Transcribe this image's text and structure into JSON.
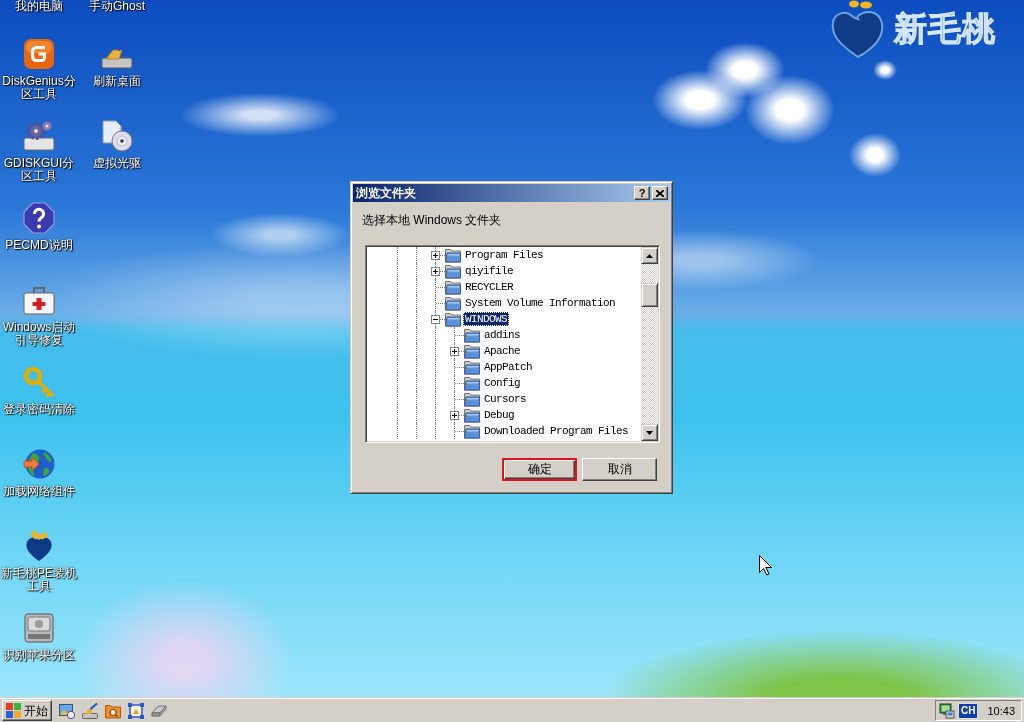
{
  "desktop_icons": {
    "columns": [
      [
        {
          "label": "我的电脑"
        },
        {
          "label": "DiskGenius分区工具"
        },
        {
          "label": "GDISKGUI分区工具"
        },
        {
          "label": "PECMD说明"
        },
        {
          "label": "Windows启动引导修复"
        },
        {
          "label": "登录密码清除"
        },
        {
          "label": "加载网络组件"
        },
        {
          "label": "新毛桃PE装机工具"
        },
        {
          "label": "识别苹果分区"
        }
      ],
      [
        {
          "label": "手动Ghost"
        },
        {
          "label": "刷新桌面"
        },
        {
          "label": "虚拟光驱"
        }
      ]
    ]
  },
  "logo": {
    "text": "新毛桃"
  },
  "dialog": {
    "title": "浏览文件夹",
    "help_button": "?",
    "prompt": "选择本地 Windows 文件夹",
    "tree": {
      "items": [
        {
          "label": "Program Files",
          "has_children": true,
          "expanded": false,
          "selected": false
        },
        {
          "label": "qiyifile",
          "has_children": true,
          "expanded": false,
          "selected": false
        },
        {
          "label": "RECYCLER",
          "has_children": false,
          "expanded": false,
          "selected": false
        },
        {
          "label": "System Volume Information",
          "has_children": false,
          "expanded": false,
          "selected": false
        },
        {
          "label": "WINDOWS",
          "has_children": true,
          "expanded": true,
          "selected": true,
          "children": [
            {
              "label": "addins",
              "has_children": false,
              "expanded": false,
              "selected": false
            },
            {
              "label": "Apache",
              "has_children": true,
              "expanded": false,
              "selected": false
            },
            {
              "label": "AppPatch",
              "has_children": false,
              "expanded": false,
              "selected": false
            },
            {
              "label": "Config",
              "has_children": false,
              "expanded": false,
              "selected": false
            },
            {
              "label": "Cursors",
              "has_children": false,
              "expanded": false,
              "selected": false
            },
            {
              "label": "Debug",
              "has_children": true,
              "expanded": false,
              "selected": false
            },
            {
              "label": "Downloaded Program Files",
              "has_children": false,
              "expanded": false,
              "selected": false
            }
          ]
        }
      ]
    },
    "buttons": [
      {
        "label": "确定",
        "highlighted": true
      },
      {
        "label": "取消",
        "highlighted": false
      }
    ]
  },
  "taskbar": {
    "start_button": "开始",
    "tray": {
      "language": "CH",
      "time": "10:43"
    }
  }
}
